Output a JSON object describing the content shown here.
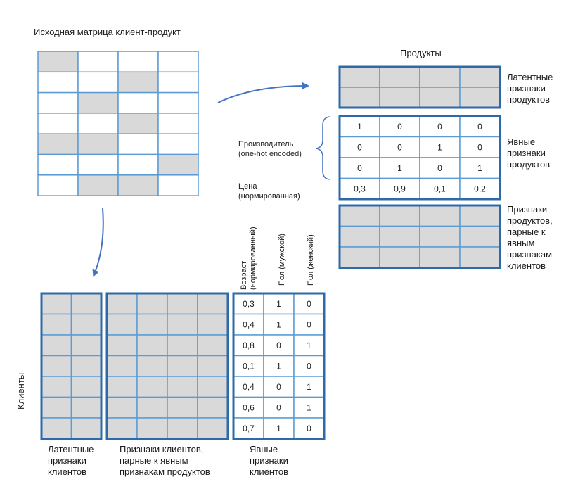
{
  "source_matrix": {
    "title": "Исходная матрица клиент-продукт",
    "rows": 7,
    "cols": 4,
    "filled": [
      [
        0,
        0
      ],
      [
        1,
        2
      ],
      [
        2,
        1
      ],
      [
        3,
        2
      ],
      [
        4,
        0
      ],
      [
        4,
        1
      ],
      [
        5,
        3
      ],
      [
        6,
        1
      ],
      [
        6,
        2
      ]
    ]
  },
  "products": {
    "title": "Продукты",
    "latent_label": [
      "Латентные",
      "признаки",
      "продуктов"
    ],
    "explicit_label": [
      "Явные",
      "признаки",
      "продуктов"
    ],
    "paired_label": [
      "Признаки",
      "продуктов,",
      "парные к",
      "явным",
      "признакам",
      "клиентов"
    ],
    "manufacturer_label": [
      "Производитель",
      "(one-hot encoded)"
    ],
    "price_label": [
      "Цена",
      "(нормированная)"
    ],
    "explicit_values": [
      [
        "1",
        "0",
        "0",
        "0"
      ],
      [
        "0",
        "0",
        "1",
        "0"
      ],
      [
        "0",
        "1",
        "0",
        "1"
      ],
      [
        "0,3",
        "0,9",
        "0,1",
        "0,2"
      ]
    ]
  },
  "clients": {
    "axis_label": "Клиенты",
    "latent_label": [
      "Латентные",
      "признаки",
      "клиентов"
    ],
    "paired_label": [
      "Признаки клиентов,",
      "парные к явным",
      "признакам продуктов"
    ],
    "explicit_label": [
      "Явные",
      "признаки",
      "клиентов"
    ],
    "explicit_headers": [
      [
        "Возраст",
        "(нормированный)"
      ],
      [
        "Пол (мужской)"
      ],
      [
        "Пол (женский)"
      ]
    ],
    "explicit_values": [
      [
        "0,3",
        "1",
        "0"
      ],
      [
        "0,4",
        "1",
        "0"
      ],
      [
        "0,8",
        "0",
        "1"
      ],
      [
        "0,1",
        "1",
        "0"
      ],
      [
        "0,4",
        "0",
        "1"
      ],
      [
        "0,6",
        "0",
        "1"
      ],
      [
        "0,7",
        "1",
        "0"
      ]
    ]
  },
  "colors": {
    "grid_line": "#5b9bd5",
    "border": "#2e6aa7",
    "fill": "#d9d9d9",
    "arrow": "#4472c4"
  }
}
